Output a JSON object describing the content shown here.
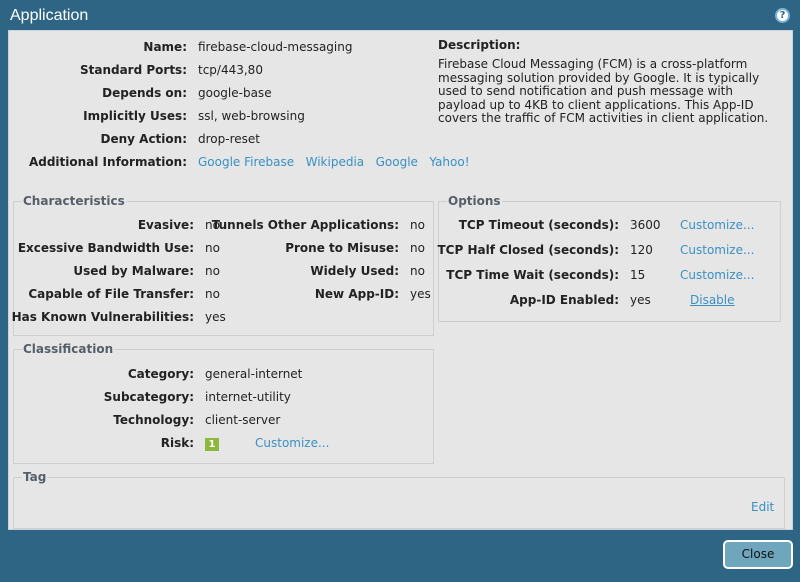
{
  "title": "Application",
  "info": [
    {
      "label": "Name:",
      "value": "firebase-cloud-messaging"
    },
    {
      "label": "Standard Ports:",
      "value": "tcp/443,80"
    },
    {
      "label": "Depends on:",
      "value": "google-base"
    },
    {
      "label": "Implicitly Uses:",
      "value": "ssl, web-browsing"
    },
    {
      "label": "Deny Action:",
      "value": "drop-reset"
    }
  ],
  "additional": {
    "label": "Additional Information:",
    "links": [
      "Google Firebase",
      "Wikipedia",
      "Google",
      "Yahoo!"
    ]
  },
  "description": {
    "label": "Description:",
    "text": "Firebase Cloud Messaging (FCM) is a cross-platform messaging solution provided by Google. It is typically used to send notification and push message with payload up to 4KB to client applications. This App-ID covers the traffic of FCM activities in client application."
  },
  "characteristics": {
    "title": "Characteristics",
    "left": [
      {
        "label": "Evasive:",
        "value": "no"
      },
      {
        "label": "Excessive Bandwidth Use:",
        "value": "no"
      },
      {
        "label": "Used by Malware:",
        "value": "no"
      },
      {
        "label": "Capable of File Transfer:",
        "value": "no"
      },
      {
        "label": "Has Known Vulnerabilities:",
        "value": "yes"
      }
    ],
    "right": [
      {
        "label": "Tunnels Other Applications:",
        "value": "no"
      },
      {
        "label": "Prone to Misuse:",
        "value": "no"
      },
      {
        "label": "Widely Used:",
        "value": "no"
      },
      {
        "label": "New App-ID:",
        "value": "yes"
      }
    ]
  },
  "options": {
    "title": "Options",
    "rows": [
      {
        "label": "TCP Timeout (seconds):",
        "value": "3600",
        "action": "Customize..."
      },
      {
        "label": "TCP Half Closed (seconds):",
        "value": "120",
        "action": "Customize..."
      },
      {
        "label": "TCP Time Wait (seconds):",
        "value": "15",
        "action": "Customize..."
      },
      {
        "label": "App-ID Enabled:",
        "value": "yes",
        "action": "Disable"
      }
    ]
  },
  "classification": {
    "title": "Classification",
    "rows": [
      {
        "label": "Category:",
        "value": "general-internet"
      },
      {
        "label": "Subcategory:",
        "value": "internet-utility"
      },
      {
        "label": "Technology:",
        "value": "client-server"
      }
    ],
    "risk": {
      "label": "Risk:",
      "value": "1",
      "action": "Customize..."
    }
  },
  "tag": {
    "title": "Tag",
    "edit": "Edit"
  },
  "close": "Close",
  "colors": {
    "header": "#2f6584",
    "link": "#3a8fc4",
    "risk": "#8cb83c"
  }
}
